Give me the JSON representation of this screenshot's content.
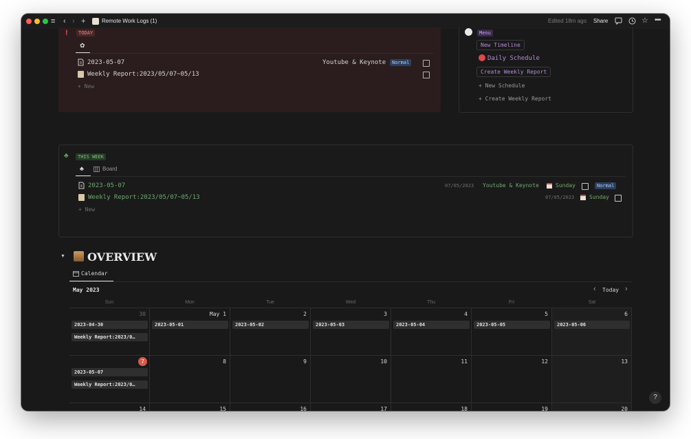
{
  "titlebar": {
    "page_title": "Remote Work Logs (1)",
    "edited": "Edited 18m ago",
    "share": "Share"
  },
  "today": {
    "label": "TODAY",
    "rows": [
      {
        "title": "2023-05-07",
        "tag": "Youtube & Keynote",
        "status": "Normal"
      },
      {
        "title": "Weekly Report:2023/05/07~05/13"
      }
    ],
    "new": "+ New"
  },
  "menu": {
    "label": "Menu",
    "new_timeline": "New Timeline",
    "daily_schedule": "Daily Schedule",
    "create_weekly": "Create Weekly Report",
    "new_schedule": "+ New Schedule",
    "create_weekly_link": "+ Create Weekly Report"
  },
  "week": {
    "label": "THIS WEEK",
    "tab_board": "Board",
    "rows": [
      {
        "title": "2023-05-07",
        "date": "07/05/2023",
        "tag": "Youtube & Keynote",
        "day": "Sunday",
        "status": "Normal"
      },
      {
        "title": "Weekly Report:2023/05/07~05/13",
        "date": "07/05/2023",
        "day": "Sunday"
      }
    ],
    "new": "+ New"
  },
  "overview": {
    "title": "OVERVIEW",
    "tab_calendar": "Calendar",
    "month": "May 2023",
    "today": "Today",
    "days": [
      "Sun",
      "Mon",
      "Tue",
      "Wed",
      "Thu",
      "Fri",
      "Sat"
    ],
    "week1": [
      "30",
      "May 1",
      "2",
      "3",
      "4",
      "5",
      "6"
    ],
    "week1_cards": [
      "2023-04-30",
      "2023-05-01",
      "2023-05-02",
      "2023-05-03",
      "2023-05-04",
      "2023-05-05",
      "2023-05-06"
    ],
    "week1_report": "Weekly Report:2023/0…",
    "week2": [
      "7",
      "8",
      "9",
      "10",
      "11",
      "12",
      "13"
    ],
    "week2_cards": [
      "2023-05-07"
    ],
    "week2_report": "Weekly Report:2023/0…",
    "week3": [
      "14",
      "15",
      "16",
      "17",
      "18",
      "19",
      "20"
    ]
  },
  "help": "?"
}
